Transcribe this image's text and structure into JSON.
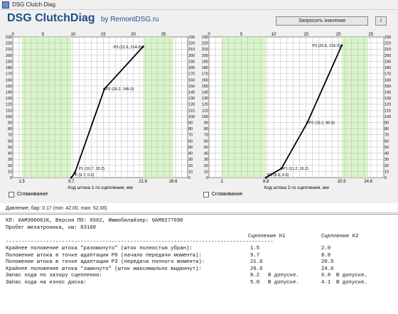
{
  "window": {
    "title": "DSG Clutch Diag"
  },
  "header": {
    "brand": "DSG ClutchDiag",
    "brand_sub": "by RemontDSG.ru",
    "request_button": "Запросить значения",
    "small_button": "i"
  },
  "checkboxes": [
    {
      "label": "Сглаживание"
    },
    {
      "label": "Сглаживание"
    }
  ],
  "status": "Давление, бар: 0.17 (min: 42.00, max: 52.00)",
  "colors": {
    "green_zone": "#d8f5c8",
    "grid": "#b8b8b8",
    "curve": "#000000",
    "bg": "#ffffff"
  },
  "chart_data": [
    {
      "type": "line",
      "title": "",
      "xlabel": "Ход штока 1-го сцепления, мм",
      "ylabel": "",
      "x_range": [
        0,
        29
      ],
      "y_range": [
        0,
        230
      ],
      "y_ticks": [
        0,
        10,
        20,
        30,
        40,
        50,
        60,
        70,
        80,
        90,
        100,
        110,
        120,
        130,
        140,
        150,
        160,
        170,
        180,
        190,
        200,
        210,
        220,
        230
      ],
      "top_ticks": [
        "0",
        "5",
        "10",
        "15",
        "20",
        "25"
      ],
      "top_tick_values": [
        0,
        5,
        10,
        15,
        20,
        25
      ],
      "bottom_ticks": [
        "1.5",
        "9.7",
        "21.6",
        "26.6"
      ],
      "bottom_tick_values": [
        1.5,
        9.7,
        21.6,
        26.6
      ],
      "green_zones": [
        [
          1.5,
          9.7
        ],
        [
          21.6,
          26.6
        ]
      ],
      "series": [
        {
          "points": [
            [
              9.7,
              0
            ],
            [
              10.3,
              8
            ],
            [
              15.2,
              145
            ],
            [
              21.6,
              214
            ]
          ]
        }
      ],
      "point_labels": [
        {
          "text": "P3 (21.6, 214.0)",
          "x": 21.6,
          "y": 214
        },
        {
          "text": "P2 (15.2, 145.0)",
          "x": 15.2,
          "y": 145
        },
        {
          "text": "P1 (10.7, 15.2)",
          "x": 10.7,
          "y": 15
        },
        {
          "text": "P0 (9.7, 0.0)",
          "x": 9.7,
          "y": 0
        }
      ]
    },
    {
      "type": "line",
      "title": "",
      "xlabel": "Ход штока 2-го сцепления, мм",
      "ylabel": "",
      "x_range": [
        0,
        27
      ],
      "y_range": [
        0,
        230
      ],
      "y_ticks": [
        0,
        10,
        20,
        30,
        40,
        50,
        60,
        70,
        80,
        90,
        100,
        110,
        120,
        130,
        140,
        150,
        160,
        170,
        180,
        190,
        200,
        210,
        220,
        230
      ],
      "top_ticks": [
        "0",
        "5",
        "10",
        "15",
        "20",
        "25"
      ],
      "top_tick_values": [
        0,
        5,
        10,
        15,
        20,
        25
      ],
      "bottom_ticks": [
        "2",
        "8.8",
        "20.5",
        "24.6"
      ],
      "bottom_tick_values": [
        2,
        8.8,
        20.5,
        24.6
      ],
      "green_zones": [
        [
          2,
          8.8
        ],
        [
          20.5,
          24.6
        ]
      ],
      "series": [
        {
          "points": [
            [
              8.8,
              0
            ],
            [
              11.2,
              15
            ],
            [
              15.2,
              90
            ],
            [
              20.5,
              216
            ]
          ]
        }
      ],
      "point_labels": [
        {
          "text": "P3 (20.5, 216.0)",
          "x": 20.5,
          "y": 216
        },
        {
          "text": "P2 (15.2, 90.0)",
          "x": 15.2,
          "y": 90
        },
        {
          "text": "P1 (11.2, 15.2)",
          "x": 11.2,
          "y": 15
        },
        {
          "text": "P0 (8.8, 0.0)",
          "x": 8.8,
          "y": 0
        }
      ]
    }
  ],
  "report": {
    "line1": "КП: 0AM300061K, Версия ПО: 6562, Иммобилайзер: 0AM927769D",
    "line2": "Пробег мехатроника, км: 83100",
    "header_k1": "Сцепление К1",
    "header_k2": "Сцепление К2",
    "divider": "--------------------------------------------------------------------------------------",
    "rows": [
      {
        "label": "Крайнее положение штока \"разомкнуто\" (шток полностью убран):",
        "k1": "1.5",
        "k1_note": "",
        "k2": "2.0",
        "k2_note": ""
      },
      {
        "label": "Положение штока в точке адаптации P0 (начало передачи момента):",
        "k1": "9.7",
        "k1_note": "",
        "k2": "8.8",
        "k2_note": ""
      },
      {
        "label": "Положение штока в точке адаптации P3 (передача полного момента):",
        "k1": "21.6",
        "k1_note": "",
        "k2": "20.5",
        "k2_note": ""
      },
      {
        "label": "Крайнее положение штока \"замкнуто\" (шток максимально выдвинут):",
        "k1": "26.6",
        "k1_note": "",
        "k2": "24.6",
        "k2_note": ""
      },
      {
        "label": "Запас хода по зазору сцепления:",
        "k1": "8.2",
        "k1_note": "В допуске.",
        "k2": "6.8",
        "k2_note": "В допуске."
      },
      {
        "label": "Запас хода на износ диска:",
        "k1": "5.0",
        "k1_note": "В допуске.",
        "k2": "4.1",
        "k2_note": "В допуске."
      }
    ]
  }
}
